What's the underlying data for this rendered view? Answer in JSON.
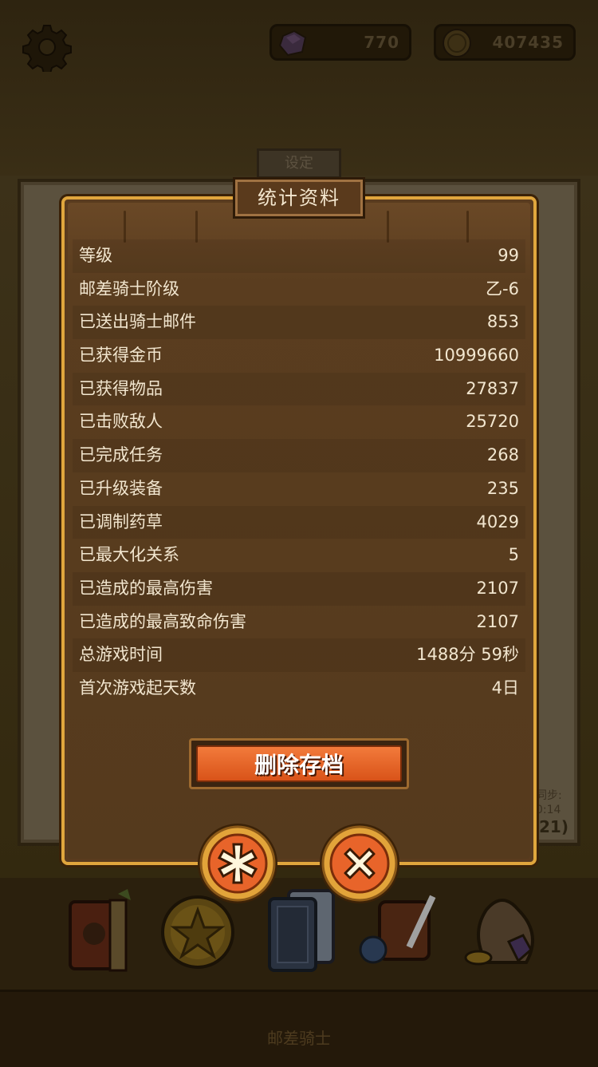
{
  "currency": {
    "gems": "770",
    "coins": "407435"
  },
  "background": {
    "tab_label": "设定",
    "sync_label": "同步:",
    "sync_time": "0:14",
    "sync_count": "21)",
    "footer_label": "邮差骑士"
  },
  "dialog": {
    "title": "统计资料",
    "stats": [
      {
        "label": "等级",
        "value": "99"
      },
      {
        "label": "邮差骑士阶级",
        "value": "乙-6"
      },
      {
        "label": "已送出骑士邮件",
        "value": "853"
      },
      {
        "label": "已获得金币",
        "value": "10999660"
      },
      {
        "label": "已获得物品",
        "value": "27837"
      },
      {
        "label": "已击败敌人",
        "value": "25720"
      },
      {
        "label": "已完成任务",
        "value": "268"
      },
      {
        "label": "已升级装备",
        "value": "235"
      },
      {
        "label": "已调制药草",
        "value": "4029"
      },
      {
        "label": "已最大化关系",
        "value": "5"
      },
      {
        "label": "已造成的最高伤害",
        "value": "2107"
      },
      {
        "label": "已造成的最高致命伤害",
        "value": "2107"
      },
      {
        "label": "总游戏时间",
        "value": "1488分 59秒"
      },
      {
        "label": "首次游戏起天数",
        "value": "4日"
      }
    ],
    "delete_label": "删除存档"
  },
  "colors": {
    "dialog_border": "#e0a63d",
    "button_orange": "#e8642a",
    "text_light": "#f2e6cf"
  },
  "icons": {
    "settings": "gear-icon",
    "gem": "gem-icon",
    "coin": "coin-icon",
    "asterisk": "asterisk-icon",
    "close": "close-icon"
  }
}
